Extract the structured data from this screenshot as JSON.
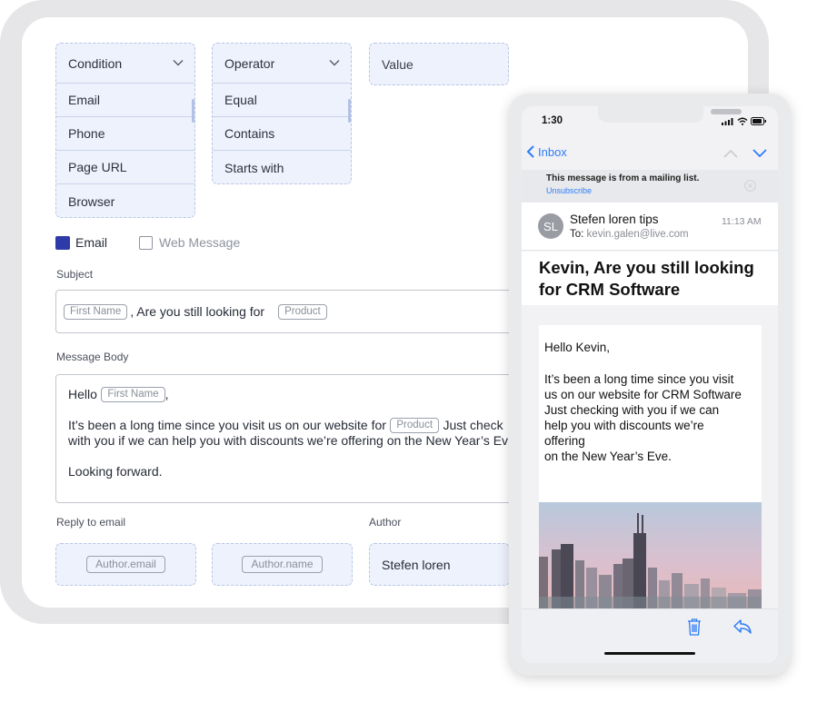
{
  "filters": {
    "condition": {
      "header": "Condition",
      "items": [
        "Email",
        "Phone",
        "Page URL",
        "Browser"
      ]
    },
    "operator": {
      "header": "Operator",
      "items": [
        "Equal",
        "Contains",
        "Starts with"
      ]
    },
    "value": {
      "placeholder": "Value"
    }
  },
  "channels": {
    "email_label": "Email",
    "email_checked": true,
    "web_label": "Web Message",
    "web_checked": false
  },
  "subject": {
    "label": "Subject",
    "token_first": "First Name",
    "text": ", Are you still looking for",
    "token_product": "Product"
  },
  "body": {
    "label": "Message Body",
    "hello": "Hello",
    "token_first": "First Name",
    "comma": ",",
    "line1_a": "It’s been a long time since you visit us on our website for",
    "token_product": "Product",
    "line1_b": "Just check",
    "line2": "with you if we can help you with discounts we’re offering  on the New Year’s Ev",
    "closing": "Looking forward."
  },
  "reply": {
    "label": "Reply to email",
    "token_email": "Author.email",
    "token_name": "Author.name"
  },
  "author": {
    "label": "Author",
    "value": "Stefen loren"
  },
  "phone": {
    "time": "1:30",
    "back_label": "Inbox",
    "mailing_notice": "This message is from a mailing list.",
    "unsubscribe": "Unsubscribe",
    "avatar_initials": "SL",
    "sender": "Stefen loren tips",
    "to_label": "To:",
    "to_address": "kevin.galen@live.com",
    "received_time": "11:13 AM",
    "subject_line1": "Kevin, Are you still looking",
    "subject_line2": "for CRM Software",
    "greeting": "Hello Kevin,",
    "body_lines": [
      "It’s been a long time since you visit",
      "us on our website for CRM Software",
      "Just checking with you if we can",
      "help you with discounts we’re",
      "offering",
      "on the New Year’s Eve."
    ]
  },
  "colors": {
    "accent": "#2e3aa8",
    "ios_blue": "#2f7cf6",
    "field_bg": "#eef2fc"
  }
}
